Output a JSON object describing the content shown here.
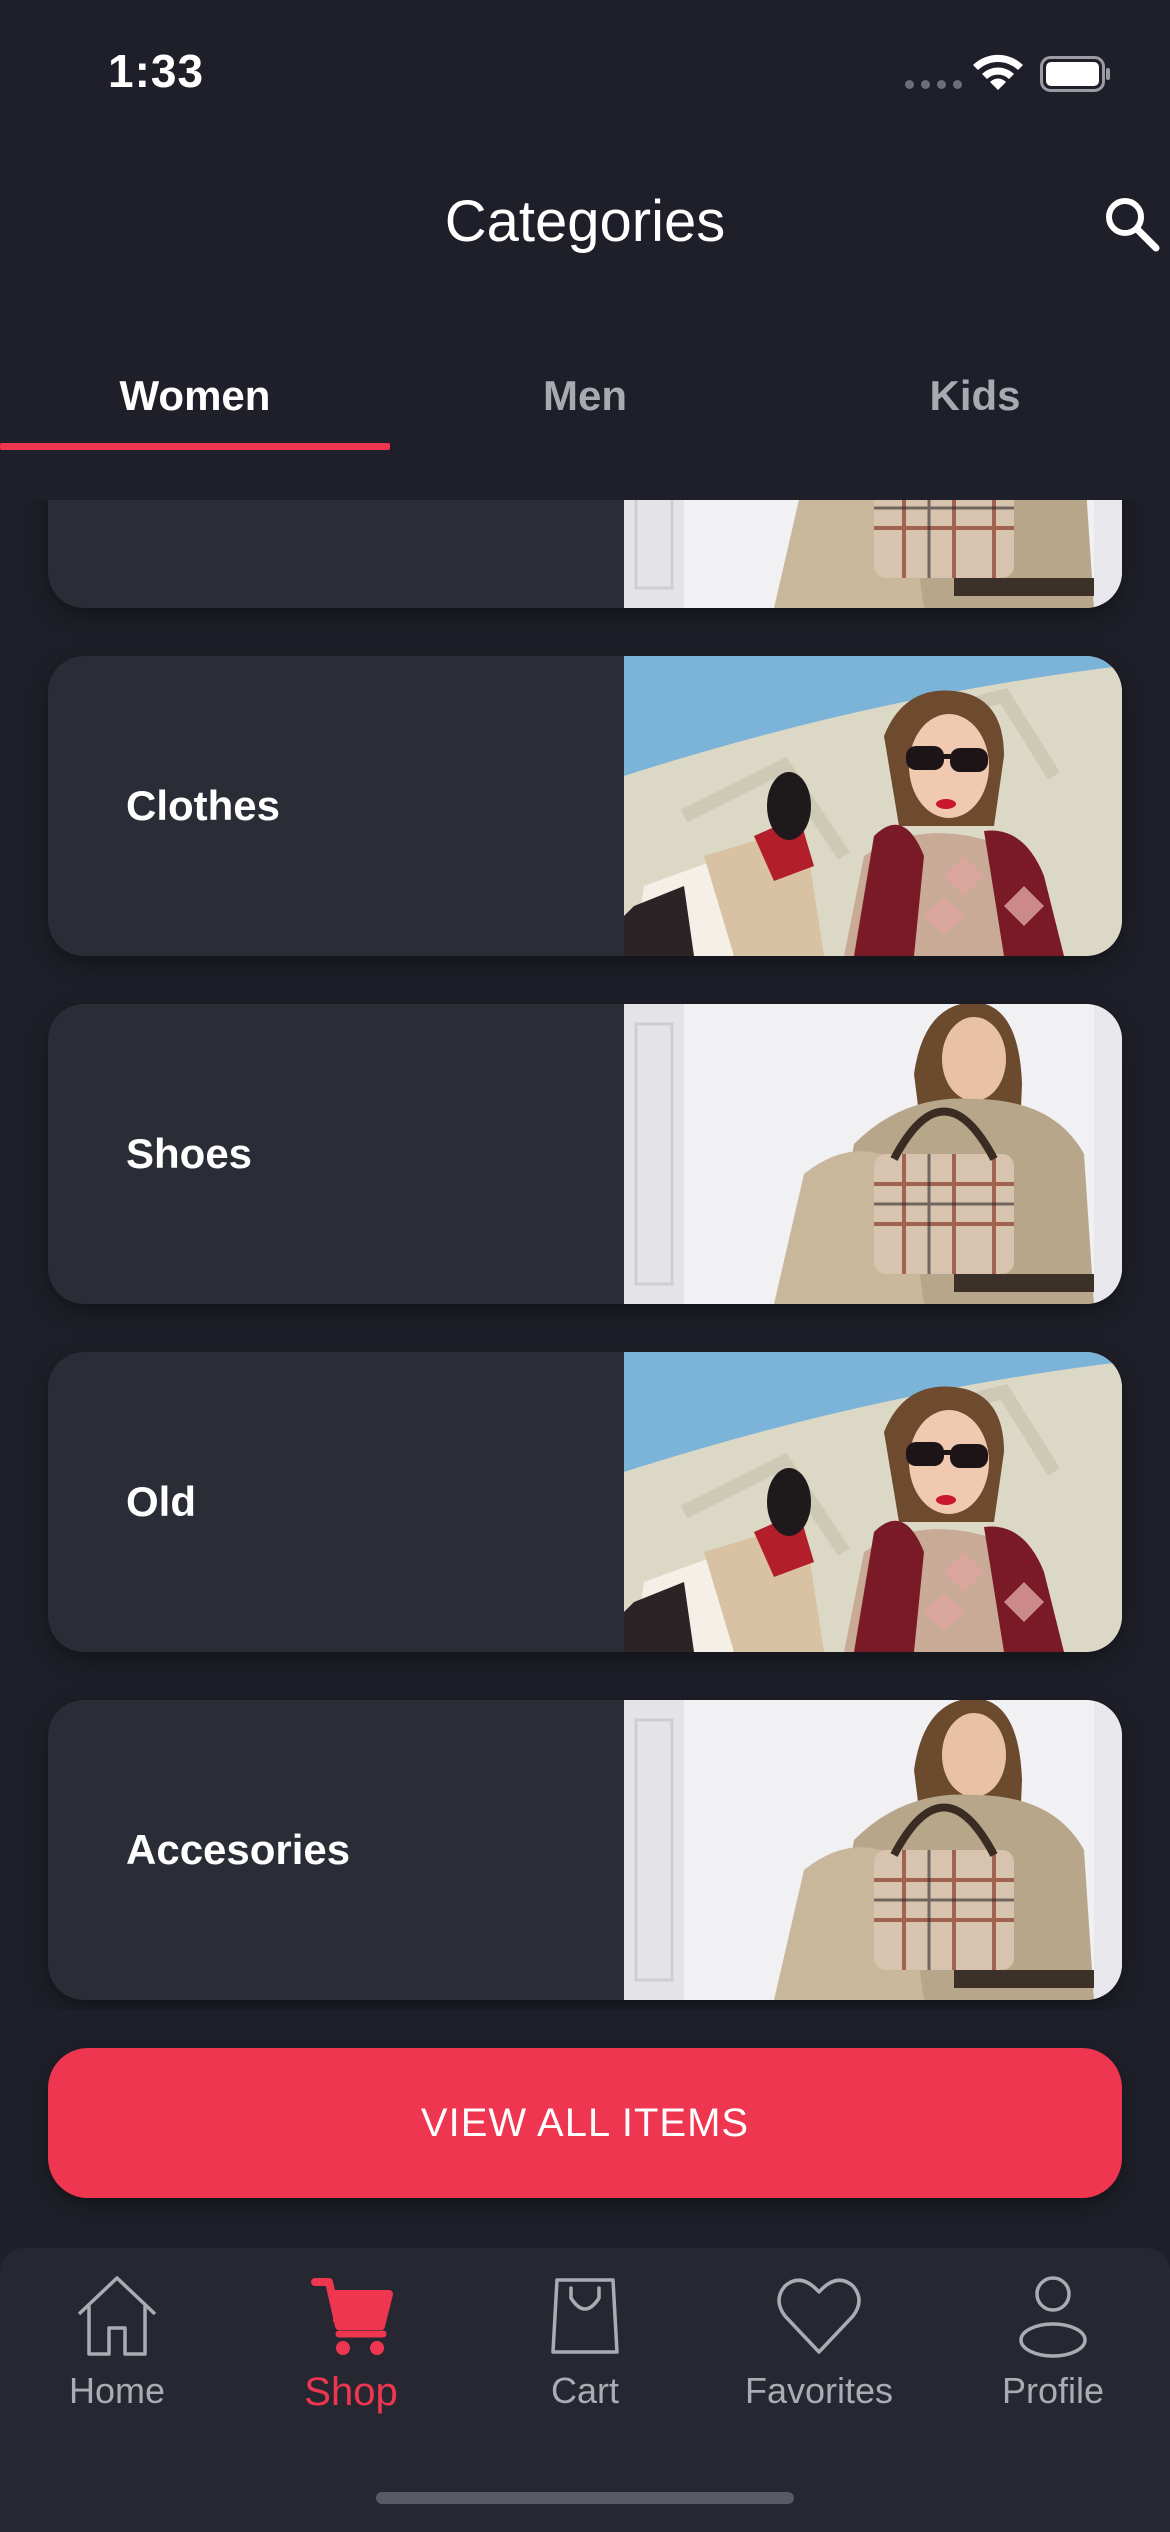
{
  "status_bar": {
    "time": "1:33"
  },
  "header": {
    "title": "Categories"
  },
  "tabs": [
    {
      "label": "Women",
      "selected": true
    },
    {
      "label": "Men",
      "selected": false
    },
    {
      "label": "Kids",
      "selected": false
    }
  ],
  "categories": [
    {
      "label": ""
    },
    {
      "label": "Clothes"
    },
    {
      "label": "Shoes"
    },
    {
      "label": "Old"
    },
    {
      "label": "Accesories"
    }
  ],
  "view_all_label": "VIEW ALL ITEMS",
  "bottom_nav": [
    {
      "label": "Home",
      "icon": "home-icon",
      "active": false
    },
    {
      "label": "Shop",
      "icon": "cart-icon",
      "active": true
    },
    {
      "label": "Cart",
      "icon": "bag-icon",
      "active": false
    },
    {
      "label": "Favorites",
      "icon": "heart-icon",
      "active": false
    },
    {
      "label": "Profile",
      "icon": "profile-icon",
      "active": false
    }
  ],
  "colors": {
    "accent": "#ef3651",
    "background": "#1e1f28",
    "card": "#2a2c36",
    "nav": "#262731"
  }
}
